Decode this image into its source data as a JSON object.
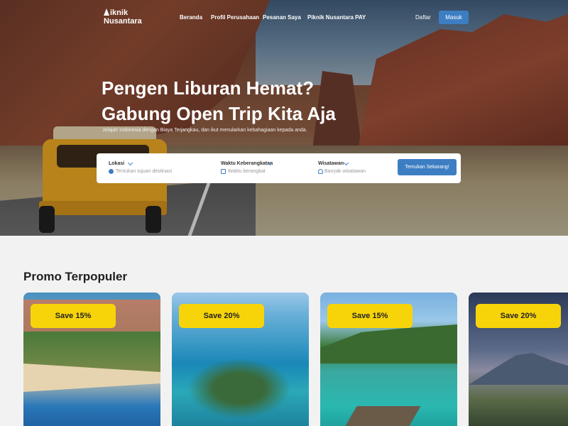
{
  "brand": {
    "logo_line1": "iknik",
    "logo_line2": "Nusantara"
  },
  "nav": {
    "links": [
      "Beranda",
      "Profil Perusahaan",
      "Pesanan Saya",
      "Piknik Nusantara PAY"
    ],
    "register_label": "Daftar",
    "login_label": "Masuk"
  },
  "hero": {
    "headline_line1": "Pengen Liburan Hemat?",
    "headline_line2": "Gabung Open Trip Kita Aja",
    "subtitle": "Jelajah Indonesia dengan Biaya Terjangkau, dan ikut menularkan kebahagiaan kepada anda."
  },
  "search": {
    "location": {
      "label": "Lokasi",
      "placeholder": "Tentukan tujuan destinasi",
      "icon": "globe-icon"
    },
    "departure": {
      "label": "Waktu Keberangkatan",
      "placeholder": "Waktu berangkat",
      "icon": "calendar-icon"
    },
    "travelers": {
      "label": "Wisatawan",
      "placeholder": "Banyak wisatawan",
      "icon": "people-icon"
    },
    "submit_label": "Temukan Sekarang!"
  },
  "promo": {
    "title": "Promo Terpopuler",
    "cards": [
      {
        "badge": "Save 15%"
      },
      {
        "badge": "Save 20%"
      },
      {
        "badge": "Save 15%"
      },
      {
        "badge": "Save 20%"
      }
    ]
  },
  "colors": {
    "primary": "#3d7ec3",
    "badge": "#f7d40a",
    "background": "#f2f2f2"
  }
}
